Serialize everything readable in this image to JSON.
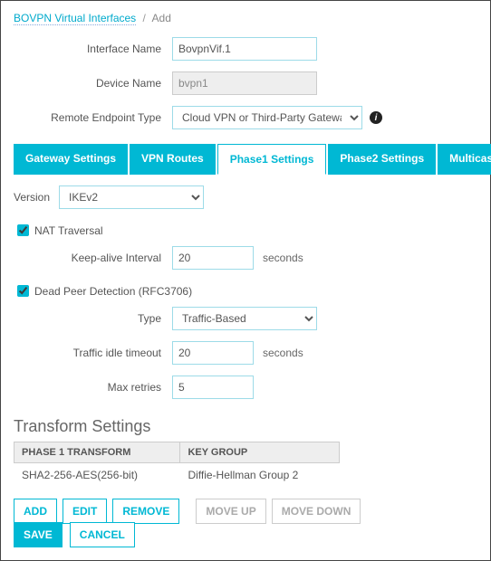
{
  "breadcrumb": {
    "parent": "BOVPN Virtual Interfaces",
    "current": "Add"
  },
  "fields": {
    "interface_name": {
      "label": "Interface Name",
      "value": "BovpnVif.1"
    },
    "device_name": {
      "label": "Device Name",
      "value": "bvpn1"
    },
    "remote_endpoint": {
      "label": "Remote Endpoint Type",
      "value": "Cloud VPN or Third-Party Gateway"
    }
  },
  "tabs": [
    {
      "label": "Gateway Settings",
      "active": false
    },
    {
      "label": "VPN Routes",
      "active": false
    },
    {
      "label": "Phase1 Settings",
      "active": true
    },
    {
      "label": "Phase2 Settings",
      "active": false
    },
    {
      "label": "Multicast Settings",
      "active": false
    }
  ],
  "phase1": {
    "version_label": "Version",
    "version_value": "IKEv2",
    "nat": {
      "label": "NAT Traversal",
      "checked": true,
      "keepalive_label": "Keep-alive Interval",
      "keepalive_value": "20",
      "keepalive_unit": "seconds"
    },
    "dpd": {
      "label": "Dead Peer Detection (RFC3706)",
      "checked": true,
      "type_label": "Type",
      "type_value": "Traffic-Based",
      "idle_label": "Traffic idle timeout",
      "idle_value": "20",
      "idle_unit": "seconds",
      "retries_label": "Max retries",
      "retries_value": "5"
    }
  },
  "transform": {
    "heading": "Transform Settings",
    "headers": {
      "col1": "PHASE 1 TRANSFORM",
      "col2": "KEY GROUP"
    },
    "rows": [
      {
        "c1": "SHA2-256-AES(256-bit)",
        "c2": "Diffie-Hellman Group 2"
      }
    ],
    "buttons": {
      "add": "ADD",
      "edit": "EDIT",
      "remove": "REMOVE",
      "moveup": "MOVE UP",
      "movedown": "MOVE DOWN"
    }
  },
  "footer": {
    "save": "SAVE",
    "cancel": "CANCEL"
  },
  "icons": {
    "info": "i"
  }
}
